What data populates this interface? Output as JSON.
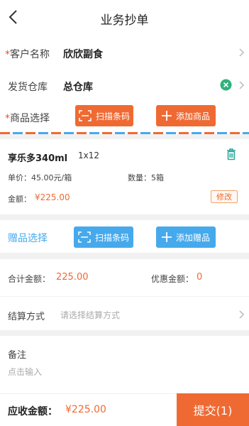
{
  "header": {
    "title": "业务抄单"
  },
  "customer": {
    "required_mark": "*",
    "label": "客户名称",
    "value": "欣欣副食"
  },
  "warehouse": {
    "label": "发货仓库",
    "value": "总仓库"
  },
  "goods": {
    "required_mark": "*",
    "label": "商品选择",
    "scan_label": "扫描条码",
    "add_label": "添加商品"
  },
  "item": {
    "name": "享乐多340ml",
    "qty_display": "1x12",
    "unit_price": "单价：45.00元/箱",
    "quantity": "数量：5箱",
    "amount_label": "金额：",
    "amount_value": "¥225.00",
    "edit_label": "修改"
  },
  "gift": {
    "label": "赠品选择",
    "scan_label": "扫描条码",
    "add_label": "添加赠品"
  },
  "totals": {
    "total_label": "合计金额：",
    "total_value": "225.00",
    "discount_label": "优惠金额：",
    "discount_value": "0"
  },
  "settlement": {
    "label": "结算方式",
    "placeholder": "请选择结算方式"
  },
  "remark": {
    "label": "备注",
    "placeholder": "点击输入"
  },
  "footer": {
    "receivable_label": "应收金额：",
    "receivable_value": "¥225.00",
    "submit_label": "提交(1)"
  },
  "colors": {
    "accent_orange": "#ef6a33",
    "accent_blue": "#46a9ec",
    "clear_green": "#2db37a",
    "delete_teal": "#28a69a"
  }
}
